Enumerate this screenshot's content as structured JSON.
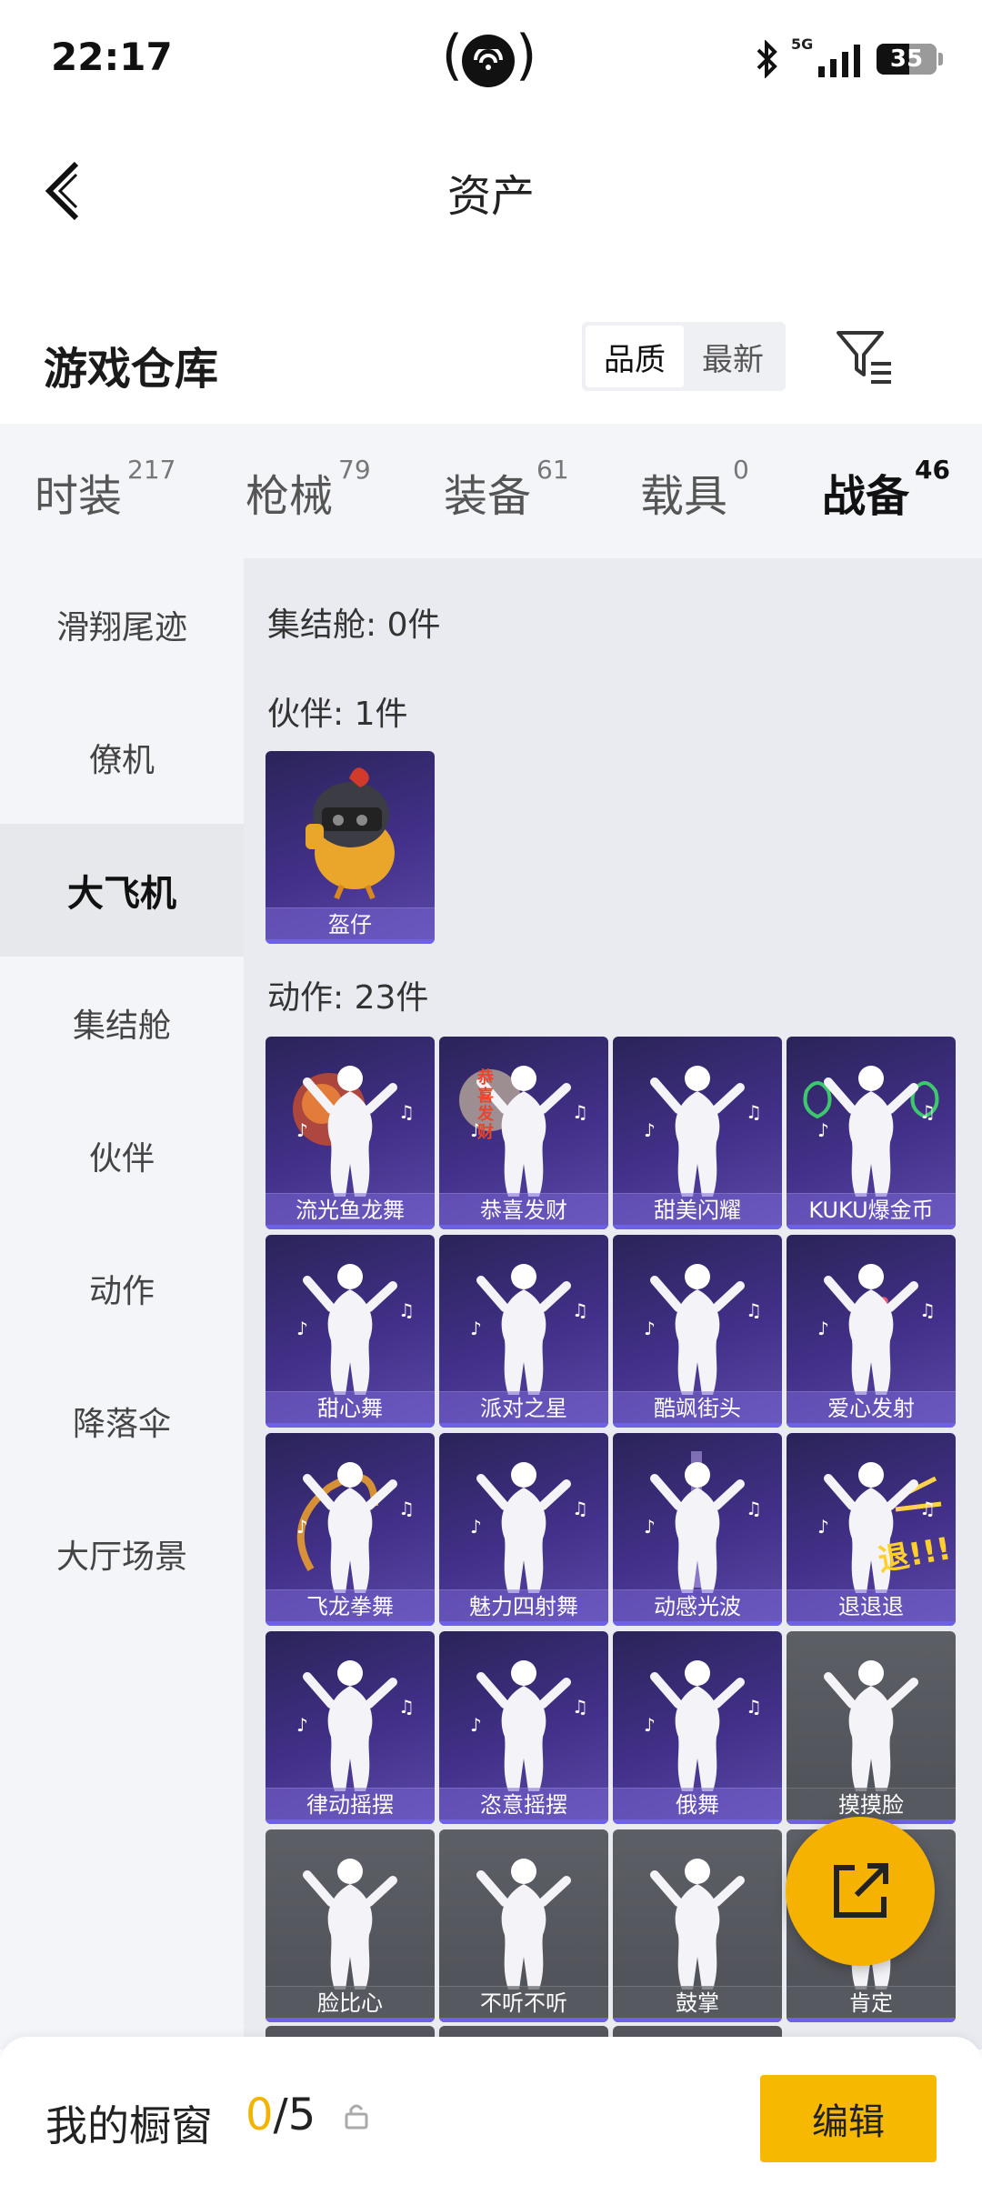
{
  "status_bar": {
    "time": "22:17",
    "network": "5G",
    "battery": "35"
  },
  "nav": {
    "title": "资产"
  },
  "header": {
    "title": "游戏仓库",
    "sort_options": [
      "品质",
      "最新"
    ],
    "active_sort": "品质"
  },
  "tabs": [
    {
      "label": "时装",
      "count": "217"
    },
    {
      "label": "枪械",
      "count": "79"
    },
    {
      "label": "装备",
      "count": "61"
    },
    {
      "label": "载具",
      "count": "0"
    },
    {
      "label": "战备",
      "count": "46"
    }
  ],
  "active_tab": "战备",
  "sidebar": {
    "items": [
      "滑翔尾迹",
      "僚机",
      "大飞机",
      "集结舱",
      "伙伴",
      "动作",
      "降落伞",
      "大厅场景"
    ],
    "active": "大飞机"
  },
  "sections": {
    "rally": {
      "title": "集结舱: 0件"
    },
    "partner": {
      "title": "伙伴: 1件",
      "items": [
        "盔仔"
      ]
    },
    "emotes": {
      "title": "动作: 23件",
      "items": [
        "流光鱼龙舞",
        "恭喜发财",
        "甜美闪耀",
        "KUKU爆金币",
        "甜心舞",
        "派对之星",
        "酷飒街头",
        "爱心发射",
        "飞龙拳舞",
        "魅力四射舞",
        "动感光波",
        "退退退",
        "律动摇摆",
        "恣意摇摆",
        "俄舞",
        "摸摸脸",
        "脸比心",
        "不听不听",
        "鼓掌",
        "肯定"
      ]
    }
  },
  "card_text": {
    "gongxi": "恭喜发财",
    "tui": "退!!!"
  },
  "bottom": {
    "label": "我的橱窗",
    "count_current": "0",
    "count_total": "/5",
    "edit_label": "编辑"
  },
  "colors": {
    "accent": "#f6b200",
    "card_purple": "#43308a",
    "card_grey": "#55575e"
  }
}
